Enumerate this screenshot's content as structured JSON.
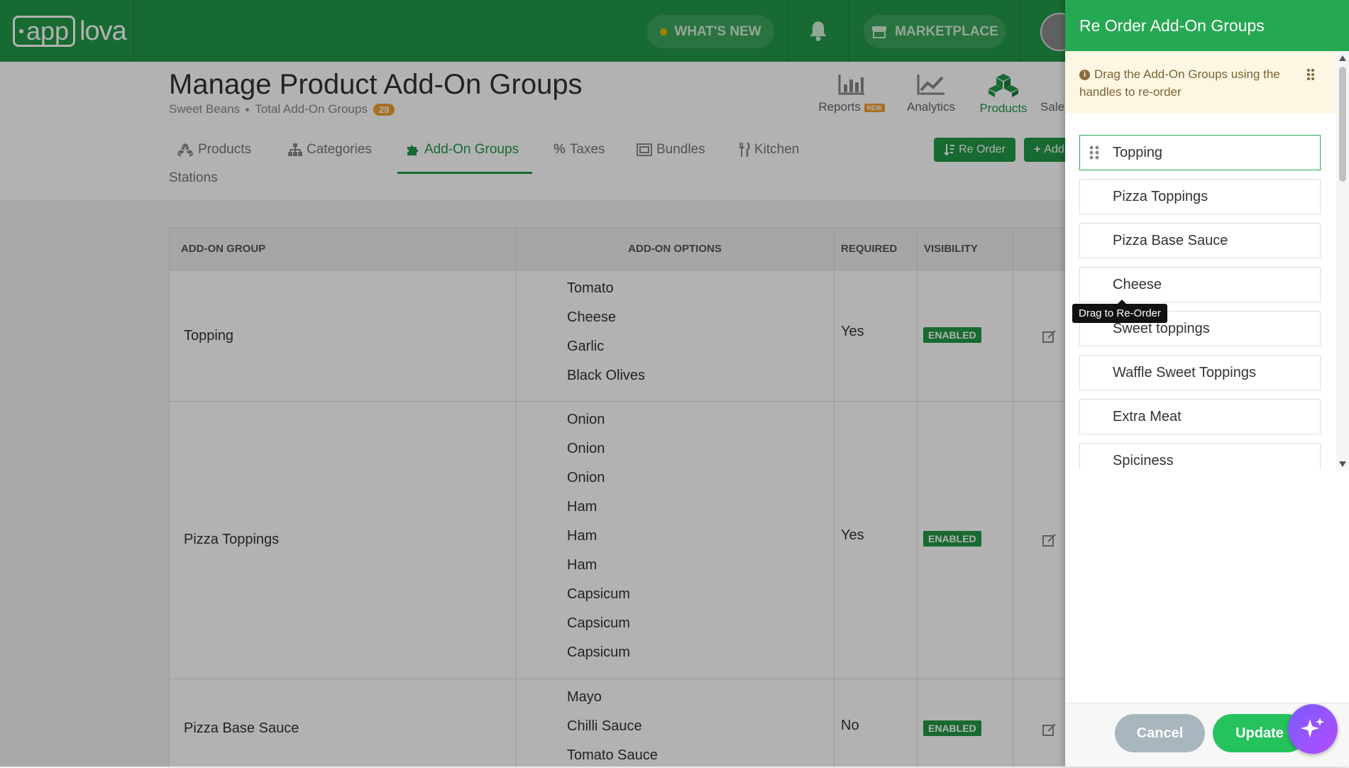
{
  "topbar": {
    "logo_app": "app",
    "logo_lova": "lova",
    "whats_new": "WHAT'S NEW",
    "marketplace": "MARKETPLACE",
    "brand_color": "#219947"
  },
  "header": {
    "title": "Manage Product Add-On Groups",
    "store": "Sweet Beans",
    "total_label": "Total Add-On Groups",
    "total_count": "29",
    "nav": [
      {
        "label": "Reports",
        "badge": "NEW",
        "icon": "bar-chart-icon"
      },
      {
        "label": "Analytics",
        "icon": "line-chart-icon"
      },
      {
        "label": "Products",
        "icon": "cubes-icon"
      },
      {
        "label": "Sale",
        "icon": "sale-icon"
      }
    ]
  },
  "tabs": {
    "items": [
      {
        "label": "Products",
        "icon": "cubes-icon"
      },
      {
        "label": "Categories",
        "icon": "sitemap-icon"
      },
      {
        "label": "Add-On Groups",
        "icon": "puzzle-icon",
        "active": true
      },
      {
        "label": "Taxes",
        "icon": "percent-icon"
      },
      {
        "label": "Bundles",
        "icon": "bundle-icon"
      },
      {
        "label": "Kitchen",
        "icon": "cutlery-icon"
      }
    ],
    "kitchen_wrap": "Stations",
    "reorder_button": "Re Order",
    "add_button": "Add"
  },
  "table": {
    "headers": {
      "group": "ADD-ON GROUP",
      "options": "ADD-ON OPTIONS",
      "required": "REQUIRED",
      "visibility": "VISIBILITY"
    },
    "rows": [
      {
        "group": "Topping",
        "options": [
          "Tomato",
          "Cheese",
          "Garlic",
          "Black Olives"
        ],
        "required": "Yes",
        "visibility": "ENABLED"
      },
      {
        "group": "Pizza Toppings",
        "options": [
          "Onion",
          "Onion",
          "Onion",
          "Ham",
          "Ham",
          "Ham",
          "Capsicum",
          "Capsicum",
          "Capsicum"
        ],
        "required": "Yes",
        "visibility": "ENABLED"
      },
      {
        "group": "Pizza Base Sauce",
        "options": [
          "Mayo",
          "Chilli Sauce",
          "Tomato Sauce"
        ],
        "required": "No",
        "visibility": "ENABLED"
      }
    ]
  },
  "panel": {
    "title": "Re Order Add-On Groups",
    "notice": "Drag the Add-On Groups using the handles to re-order",
    "tooltip": "Drag to Re-Order",
    "items": [
      "Topping",
      "Pizza Toppings",
      "Pizza Base Sauce",
      "Cheese",
      "Sweet toppings",
      "Waffle Sweet Toppings",
      "Extra Meat",
      "Spiciness"
    ],
    "cancel": "Cancel",
    "update": "Update"
  }
}
